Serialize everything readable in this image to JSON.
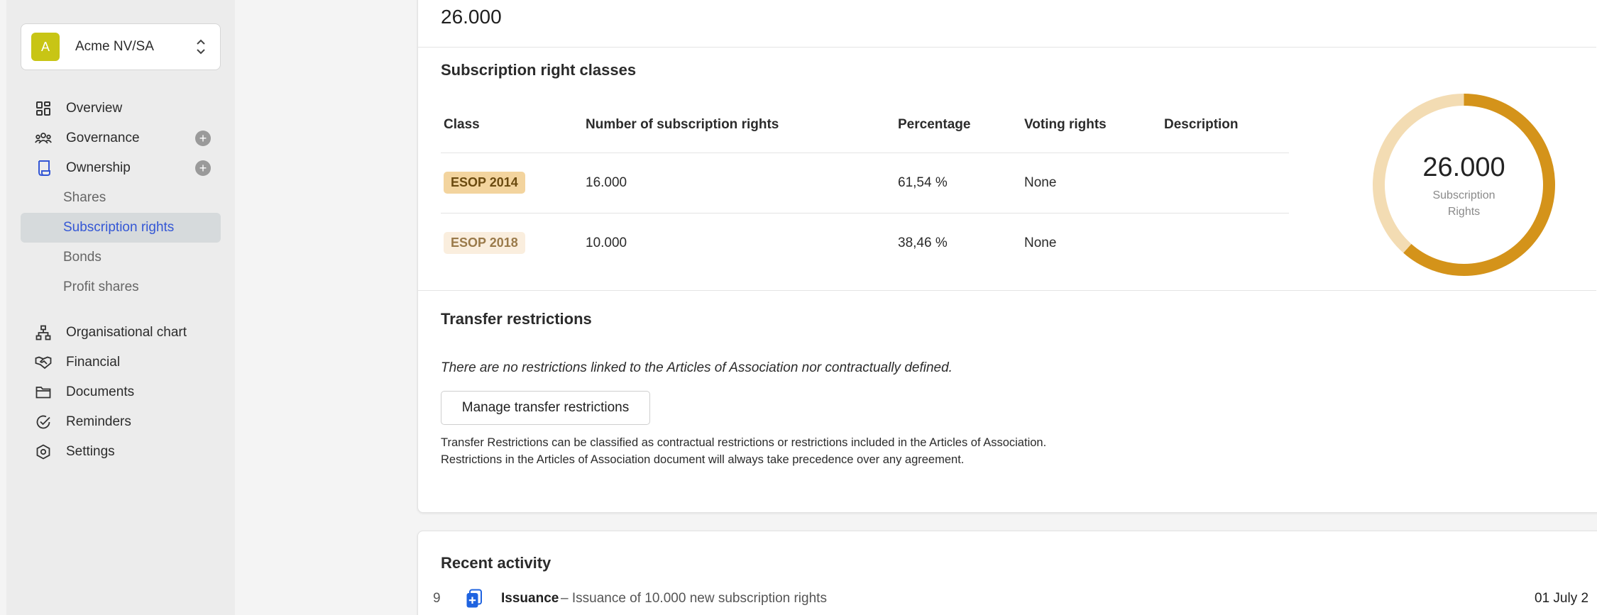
{
  "company": {
    "initial": "A",
    "name": "Acme NV/SA",
    "avatar_color": "#c8c515"
  },
  "nav": {
    "overview": "Overview",
    "governance": "Governance",
    "ownership": "Ownership",
    "sub": {
      "shares": "Shares",
      "subscription_rights": "Subscription rights",
      "bonds": "Bonds",
      "profit_shares": "Profit shares"
    },
    "org_chart": "Organisational chart",
    "financial": "Financial",
    "documents": "Documents",
    "reminders": "Reminders",
    "settings": "Settings",
    "plus": "+"
  },
  "summary": {
    "total": "26.000"
  },
  "classes": {
    "title": "Subscription right classes",
    "headers": {
      "class": "Class",
      "number": "Number of subscription rights",
      "percentage": "Percentage",
      "voting": "Voting rights",
      "description": "Description"
    },
    "rows": [
      {
        "class": "ESOP 2014",
        "number": "16.000",
        "percentage": "61,54 %",
        "voting": "None",
        "description": "",
        "color": "#d4931a"
      },
      {
        "class": "ESOP 2018",
        "number": "10.000",
        "percentage": "38,46 %",
        "voting": "None",
        "description": "",
        "color": "#f3dcb3"
      }
    ],
    "chart": {
      "total": "26.000",
      "label_line1": "Subscription",
      "label_line2": "Rights"
    }
  },
  "chart_data": {
    "type": "pie",
    "categories": [
      "ESOP 2014",
      "ESOP 2018"
    ],
    "values": [
      16000,
      10000
    ],
    "colors": [
      "#d4931a",
      "#f3dcb3"
    ],
    "center_value": "26.000",
    "center_label": "Subscription Rights"
  },
  "transfer": {
    "title": "Transfer restrictions",
    "none_text": "There are no restrictions linked to the Articles of Association nor contractually defined.",
    "button": "Manage transfer restrictions",
    "help_line1": "Transfer Restrictions can be classified as contractual restrictions or restrictions included in the Articles of Association.",
    "help_line2": "Restrictions in the Articles of Association document will always take precedence over any agreement."
  },
  "activity": {
    "title": "Recent activity",
    "items": [
      {
        "index": "9",
        "type": "Issuance",
        "description": "– Issuance of 10.000 new subscription rights",
        "date": "01 July 2"
      }
    ]
  },
  "colors": {
    "accent": "#3457d5",
    "esop2014": "#d4931a",
    "esop2018": "#f3dcb3",
    "icon_blue": "#1f63e0"
  }
}
